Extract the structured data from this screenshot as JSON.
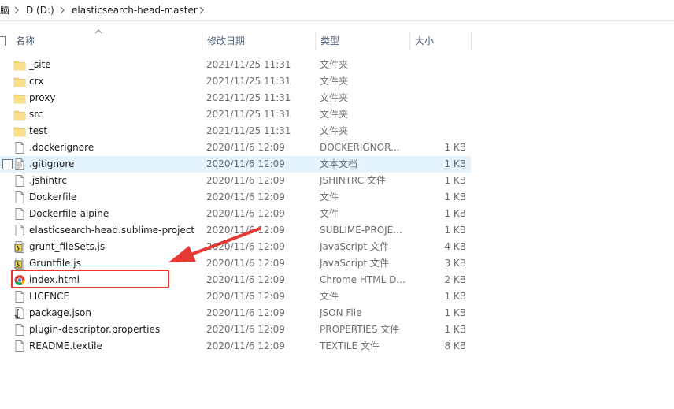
{
  "breadcrumb": {
    "root_partial": "脑",
    "drive": "D (D:)",
    "folder": "elasticsearch-head-master"
  },
  "columns": {
    "name": "名称",
    "modified": "修改日期",
    "type": "类型",
    "size": "大小"
  },
  "files": [
    {
      "name": "_site",
      "date": "2021/11/25 11:31",
      "type": "文件夹",
      "size": "",
      "icon": "folder-icon"
    },
    {
      "name": "crx",
      "date": "2021/11/25 11:31",
      "type": "文件夹",
      "size": "",
      "icon": "folder-icon"
    },
    {
      "name": "proxy",
      "date": "2021/11/25 11:31",
      "type": "文件夹",
      "size": "",
      "icon": "folder-icon"
    },
    {
      "name": "src",
      "date": "2021/11/25 11:31",
      "type": "文件夹",
      "size": "",
      "icon": "folder-icon"
    },
    {
      "name": "test",
      "date": "2021/11/25 11:31",
      "type": "文件夹",
      "size": "",
      "icon": "folder-icon"
    },
    {
      "name": ".dockerignore",
      "date": "2020/11/6 12:09",
      "type": "DOCKERIGNOR...",
      "size": "1 KB",
      "icon": "file-icon"
    },
    {
      "name": ".gitignore",
      "date": "2020/11/6 12:09",
      "type": "文本文档",
      "size": "1 KB",
      "icon": "text-file-icon"
    },
    {
      "name": ".jshintrc",
      "date": "2020/11/6 12:09",
      "type": "JSHINTRC 文件",
      "size": "1 KB",
      "icon": "file-icon"
    },
    {
      "name": "Dockerfile",
      "date": "2020/11/6 12:09",
      "type": "文件",
      "size": "1 KB",
      "icon": "file-icon"
    },
    {
      "name": "Dockerfile-alpine",
      "date": "2020/11/6 12:09",
      "type": "文件",
      "size": "1 KB",
      "icon": "file-icon"
    },
    {
      "name": "elasticsearch-head.sublime-project",
      "date": "2020/11/6 12:09",
      "type": "SUBLIME-PROJE...",
      "size": "1 KB",
      "icon": "file-icon"
    },
    {
      "name": "grunt_fileSets.js",
      "date": "2020/11/6 12:09",
      "type": "JavaScript 文件",
      "size": "4 KB",
      "icon": "js-file-icon"
    },
    {
      "name": "Gruntfile.js",
      "date": "2020/11/6 12:09",
      "type": "JavaScript 文件",
      "size": "3 KB",
      "icon": "js-file-icon"
    },
    {
      "name": "index.html",
      "date": "2020/11/6 12:09",
      "type": "Chrome HTML D...",
      "size": "2 KB",
      "icon": "chrome-icon"
    },
    {
      "name": "LICENCE",
      "date": "2020/11/6 12:09",
      "type": "文件",
      "size": "1 KB",
      "icon": "file-icon"
    },
    {
      "name": "package.json",
      "date": "2020/11/6 12:09",
      "type": "JSON File",
      "size": "1 KB",
      "icon": "json-file-icon"
    },
    {
      "name": "plugin-descriptor.properties",
      "date": "2020/11/6 12:09",
      "type": "PROPERTIES 文件",
      "size": "1 KB",
      "icon": "file-icon"
    },
    {
      "name": "README.textile",
      "date": "2020/11/6 12:09",
      "type": "TEXTILE 文件",
      "size": "8 KB",
      "icon": "file-icon"
    }
  ],
  "selected_row": ".gitignore",
  "highlighted_file": "index.html",
  "colors": {
    "selection": "#e5f3ff",
    "folder": "#f8d775",
    "annotation": "#e53935",
    "header_text": "#4c607a"
  }
}
